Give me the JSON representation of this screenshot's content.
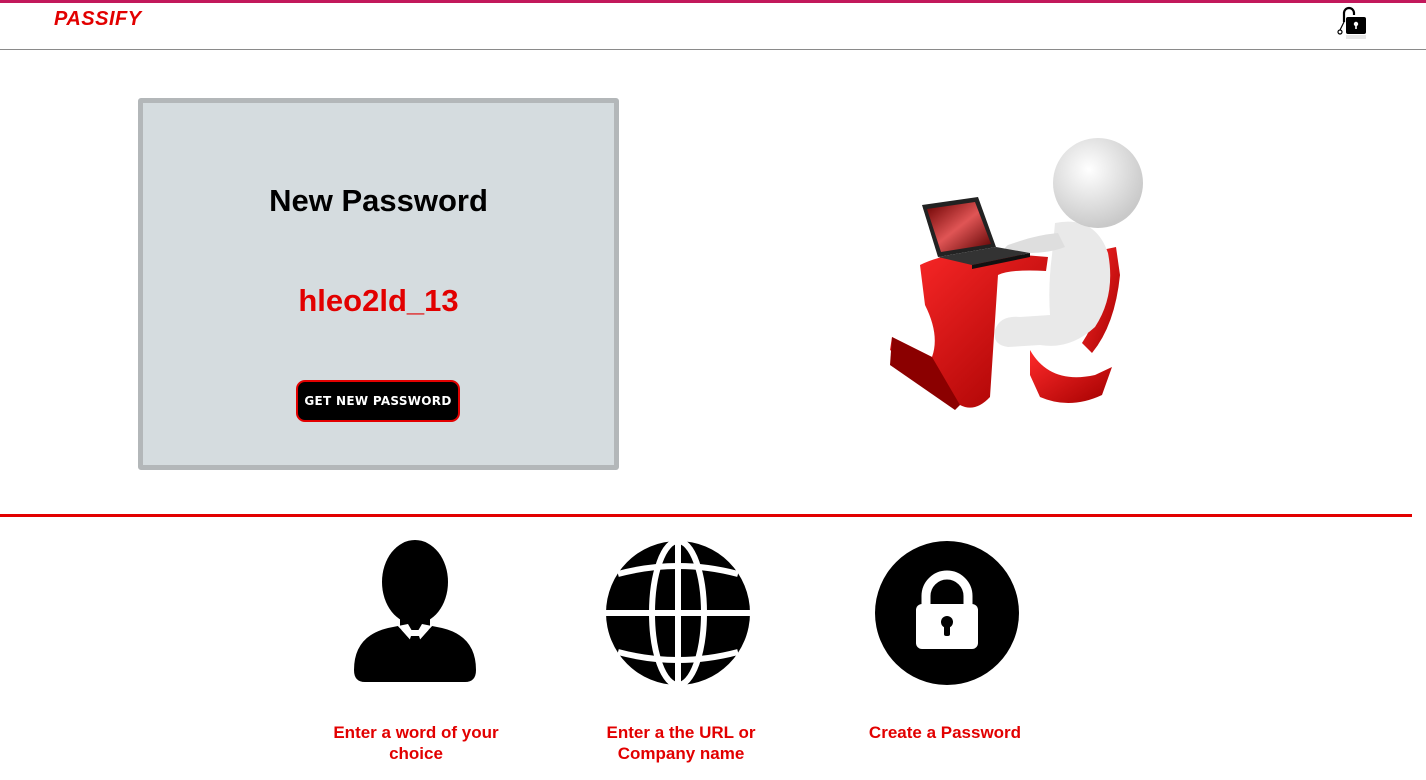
{
  "header": {
    "brand": "PASSIFY",
    "icon": "lock-icon"
  },
  "card": {
    "title": "New Password",
    "password": "hleo2ld_13",
    "button_label": "GET NEW PASSWORD"
  },
  "illustration": {
    "icon": "person-at-laptop-illustration"
  },
  "features": [
    {
      "icon": "user-icon",
      "label": "Enter a word of your choice"
    },
    {
      "icon": "globe-icon",
      "label": "Enter a the URL or Company name"
    },
    {
      "icon": "lock-icon",
      "label": "Create a Password"
    }
  ],
  "colors": {
    "accent": "#e20000",
    "header_border": "#c2185b",
    "card_bg": "#d5dcdf",
    "card_border": "#b3b7b9"
  }
}
